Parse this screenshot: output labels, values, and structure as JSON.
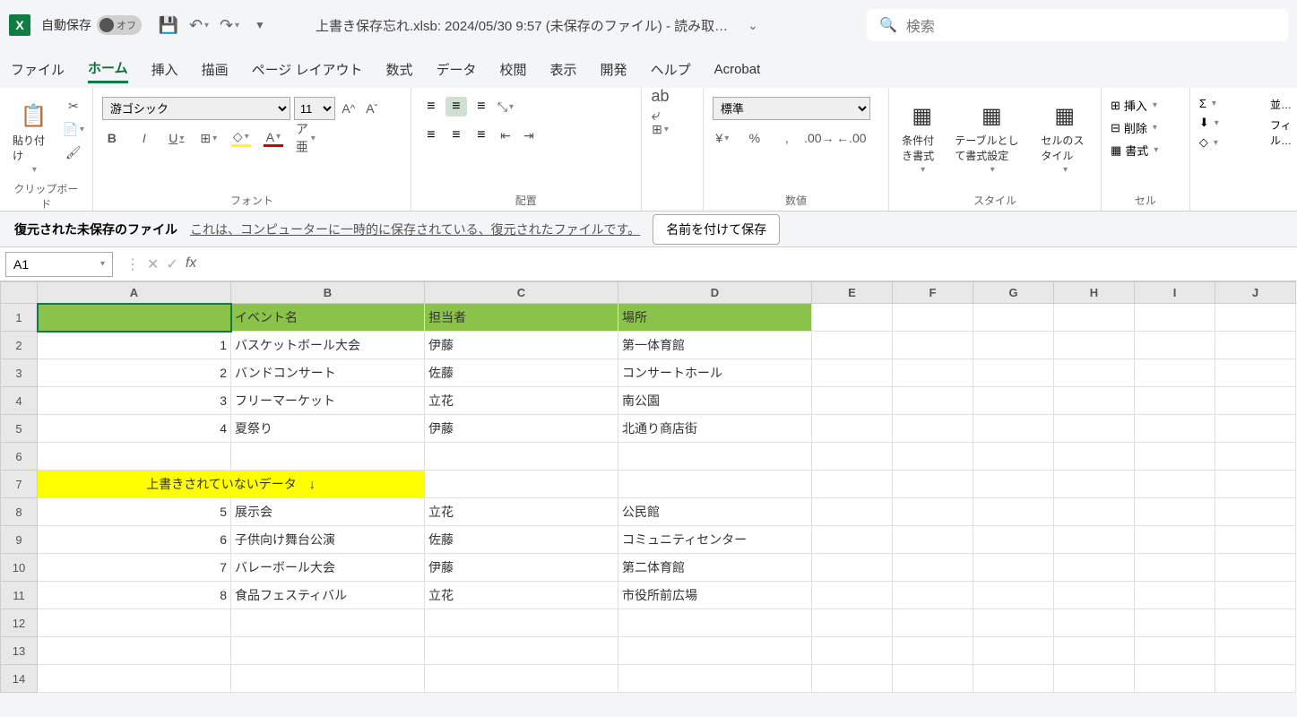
{
  "titlebar": {
    "autosave_label": "自動保存",
    "toggle_text": "オフ",
    "filename": "上書き保存忘れ.xlsb: 2024/05/30 9:57 (未保存のファイル)  -  読み取…",
    "search_placeholder": "検索"
  },
  "tabs": {
    "file": "ファイル",
    "home": "ホーム",
    "insert": "挿入",
    "draw": "描画",
    "pagelayout": "ページ レイアウト",
    "formulas": "数式",
    "data": "データ",
    "review": "校閲",
    "view": "表示",
    "developer": "開発",
    "help": "ヘルプ",
    "acrobat": "Acrobat"
  },
  "ribbon": {
    "paste": "貼り付け",
    "clipboard": "クリップボード",
    "font_name": "游ゴシック",
    "font_size": "11",
    "font_group": "フォント",
    "align_group": "配置",
    "number_format": "標準",
    "number_group": "数値",
    "cond_format": "条件付き書式",
    "table_format": "テーブルとして書式設定",
    "cell_styles": "セルのスタイル",
    "styles_group": "スタイル",
    "insert": "挿入",
    "delete": "削除",
    "format": "書式",
    "cells_group": "セル",
    "editing1": "並…",
    "editing2": "フィル…"
  },
  "infobar": {
    "title": "復元された未保存のファイル",
    "msg": "これは、コンピューターに一時的に保存されている、復元されたファイルです。",
    "save": "名前を付けて保存"
  },
  "namebox": "A1",
  "columns": [
    "A",
    "B",
    "C",
    "D",
    "E",
    "F",
    "G",
    "H",
    "I",
    "J"
  ],
  "grid": {
    "r1": {
      "A": "",
      "B": "イベント名",
      "C": "担当者",
      "D": "場所"
    },
    "r2": {
      "A": "1",
      "B": "バスケットボール大会",
      "C": "伊藤",
      "D": "第一体育館"
    },
    "r3": {
      "A": "2",
      "B": "バンドコンサート",
      "C": "佐藤",
      "D": "コンサートホール"
    },
    "r4": {
      "A": "3",
      "B": "フリーマーケット",
      "C": "立花",
      "D": "南公園"
    },
    "r5": {
      "A": "4",
      "B": "夏祭り",
      "C": "伊藤",
      "D": "北通り商店街"
    },
    "r7": {
      "A": "上書きされていないデータ　↓"
    },
    "r8": {
      "A": "5",
      "B": "展示会",
      "C": "立花",
      "D": "公民館"
    },
    "r9": {
      "A": "6",
      "B": "子供向け舞台公演",
      "C": "佐藤",
      "D": "コミュニティセンター"
    },
    "r10": {
      "A": "7",
      "B": "バレーボール大会",
      "C": "伊藤",
      "D": "第二体育館"
    },
    "r11": {
      "A": "8",
      "B": "食品フェスティバル",
      "C": "立花",
      "D": "市役所前広場"
    }
  }
}
